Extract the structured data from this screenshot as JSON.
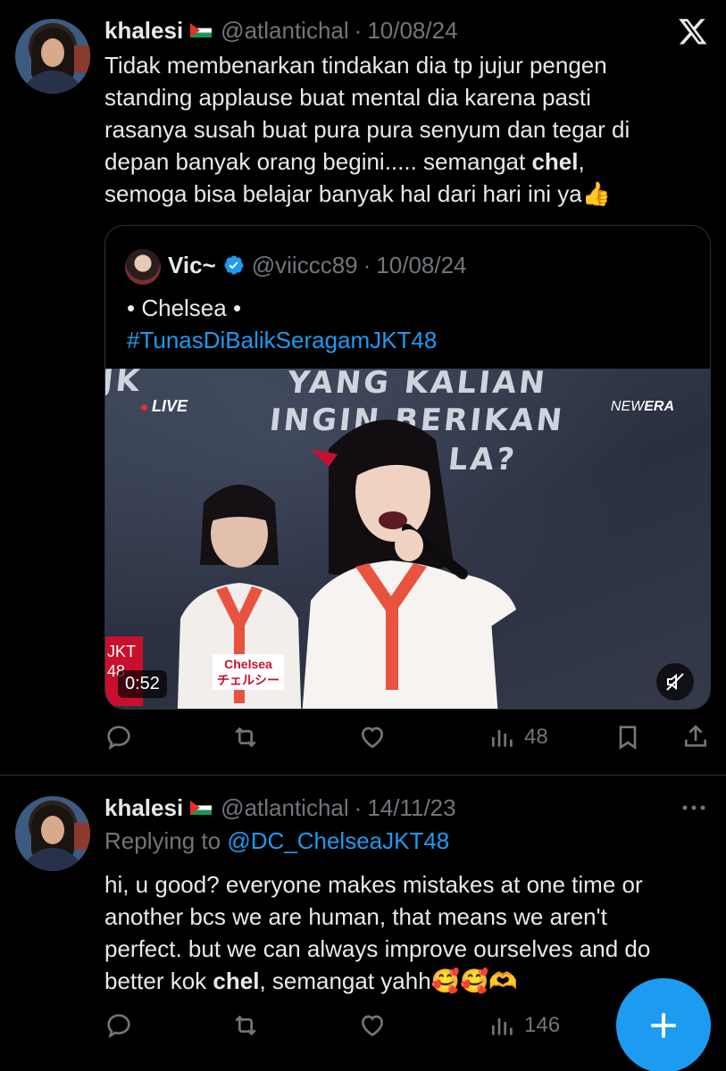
{
  "tweet1": {
    "name": "khalesi",
    "handle": "@atlantichal",
    "separator": "·",
    "date": "10/08/24",
    "text_lines": [
      "Tidak membenarkan tindakan dia tp jujur pengen",
      "standing applause buat mental dia karena pasti",
      "rasanya susah buat pura pura senyum dan tegar di",
      "depan banyak orang begini..... semangat ",
      "semoga bisa belajar banyak hal dari hari ini ya"
    ],
    "bold_word": "chel",
    "comma": ",",
    "emoji_end": "👍",
    "icons": {
      "avatar": "avatar",
      "flag": "palestine-flag-icon",
      "platform": "x-logo-icon"
    }
  },
  "quoted": {
    "name": "Vic~",
    "handle": "@viiccc89",
    "separator": "·",
    "date": "10/08/24",
    "line1": "• Chelsea •",
    "hashtag": "#TunasDiBalikSeragamJKT48",
    "video": {
      "live_label": "LIVE",
      "brand_prefix": "NEW",
      "brand_suffix": "ERA",
      "chalk_top_left": "JK",
      "chalk_line1": "YANG KALIAN",
      "chalk_line2": "INGIN BERIKAN",
      "chalk_line3": "LA?",
      "duration": "0:52",
      "logo_text_1": "JKT",
      "logo_text_2": "48",
      "nametag_en": "Chelsea",
      "nametag_jp": "チェルシー"
    },
    "icons": {
      "verified": "verified-badge-icon",
      "mute": "mute-icon"
    }
  },
  "tweet1_actions": {
    "views": "48"
  },
  "tweet2": {
    "name": "khalesi",
    "handle": "@atlantichal",
    "separator": "·",
    "date": "14/11/23",
    "replying_prefix": "Replying to ",
    "replying_mention": "@DC_ChelseaJKT48",
    "text_lines": [
      "hi, u good? everyone makes mistakes at one time or",
      "another bcs we are human, that means we aren't",
      "perfect. but we can always improve ourselves and do",
      "better kok "
    ],
    "bold_word": "chel",
    "text_end": ", semangat yahh",
    "emojis": "🥰🥰🫶"
  },
  "tweet2_actions": {
    "views": "146"
  },
  "colors": {
    "background": "#000000",
    "text": "#e7e9ea",
    "muted": "#71767b",
    "accent": "#1d9bf0",
    "border": "#2f3336"
  }
}
